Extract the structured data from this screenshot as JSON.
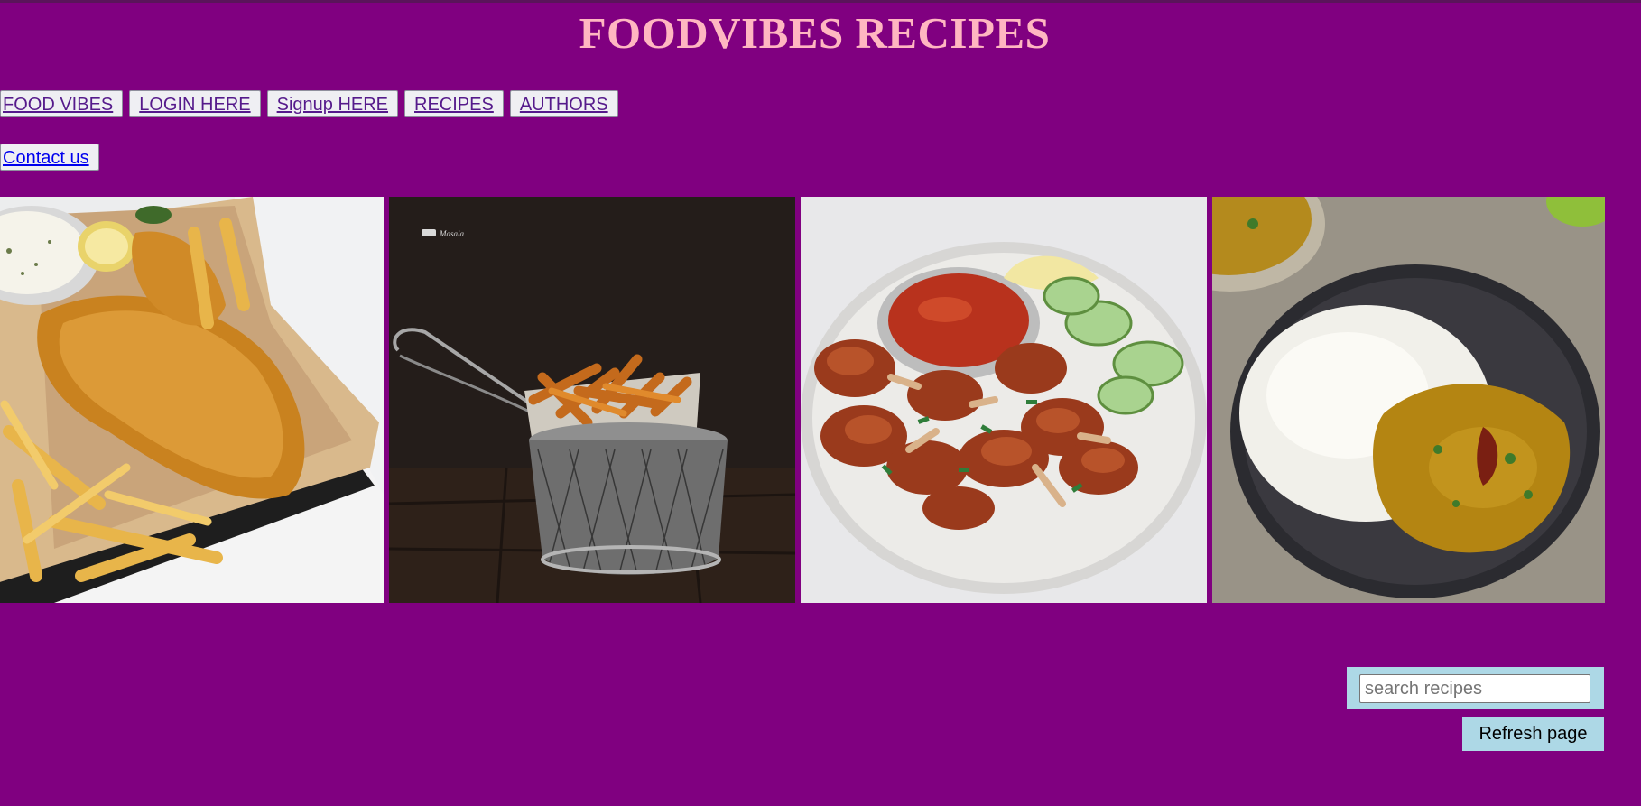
{
  "header": {
    "title": "FOODVIBES RECIPES"
  },
  "nav": {
    "row1": [
      {
        "label": "FOOD VIBES"
      },
      {
        "label": "LOGIN HERE"
      },
      {
        "label": "Signup HERE"
      },
      {
        "label": "RECIPES"
      },
      {
        "label": "AUTHORS"
      }
    ],
    "row2": [
      {
        "label": "Contact us"
      }
    ]
  },
  "gallery": {
    "images": [
      {
        "subject": "fish and chips"
      },
      {
        "subject": "fries in wire basket"
      },
      {
        "subject": "chicken lollipops with chutney"
      },
      {
        "subject": "rice and dal"
      }
    ]
  },
  "search": {
    "placeholder": "search recipes",
    "value": ""
  },
  "refresh": {
    "label": "Refresh page"
  },
  "colors": {
    "background": "#800080",
    "title": "#ffb6c1",
    "search_panel": "#add8e6",
    "link_visited": "#551a8b",
    "link": "#0000ee"
  }
}
